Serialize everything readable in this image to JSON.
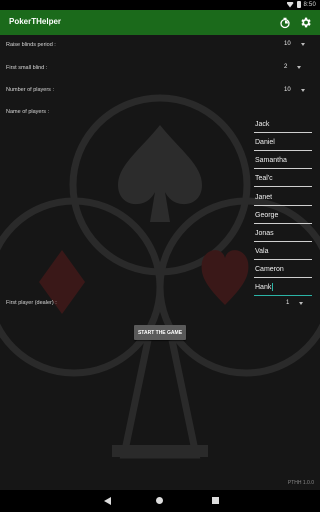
{
  "status_bar": {
    "time": "8:50"
  },
  "app": {
    "title": "PokerTHelper",
    "icons": [
      "timer-icon",
      "gear-icon"
    ]
  },
  "settings": {
    "raise_blinds_label": "Raise blinds period :",
    "raise_blinds_value": "10",
    "first_small_blind_label": "First small blind :",
    "first_small_blind_value": "2",
    "num_players_label": "Number of players :",
    "num_players_value": "10",
    "names_label": "Name of players :",
    "first_player_label": "First player (dealer) :",
    "first_player_value": "1"
  },
  "players": [
    "Jack",
    "Daniel",
    "Samantha",
    "Teal'c",
    "Janet",
    "George",
    "Jonas",
    "Vala",
    "Cameron",
    "Hank"
  ],
  "start_button": "START THE GAME",
  "version": "PTHH 1.0.0",
  "colors": {
    "appbar": "#1b6a1b",
    "accent": "#2bb4a6",
    "background": "#161616"
  }
}
